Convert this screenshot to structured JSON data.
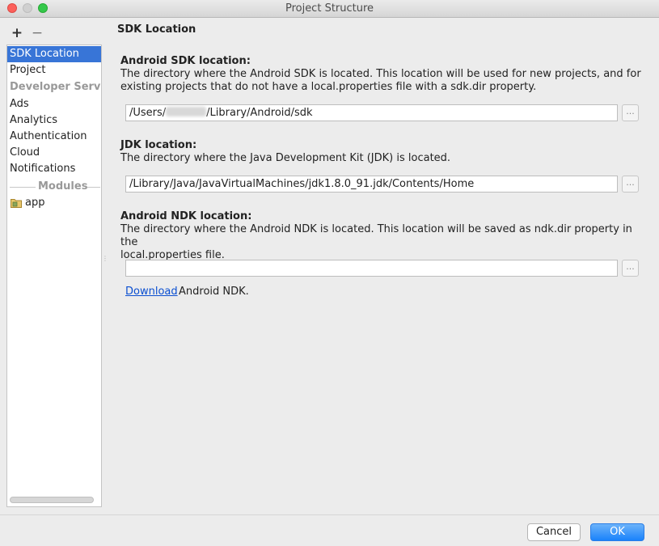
{
  "window": {
    "title": "Project Structure"
  },
  "toolbar": {
    "add_label": "+",
    "remove_label": "−"
  },
  "sidebar": {
    "items": [
      {
        "label": "SDK Location",
        "selected": true
      },
      {
        "label": "Project"
      }
    ],
    "developer_services_header": "Developer Services",
    "services": [
      "Ads",
      "Analytics",
      "Authentication",
      "Cloud",
      "Notifications"
    ],
    "modules_header": "Modules",
    "modules": [
      {
        "label": "app",
        "icon": "module-folder-icon"
      }
    ]
  },
  "content": {
    "page_title": "SDK Location",
    "android_sdk": {
      "title": "Android SDK location:",
      "desc_line1": "The directory where the Android SDK is located. This location will be used for new projects, and for",
      "desc_line2": "existing projects that do not have a local.properties file with a sdk.dir property.",
      "path_prefix": "/Users/",
      "path_suffix": "/Library/Android/sdk",
      "browse_label": "..."
    },
    "jdk": {
      "title": "JDK location:",
      "desc": "The directory where the Java Development Kit (JDK) is located.",
      "path": "/Library/Java/JavaVirtualMachines/jdk1.8.0_91.jdk/Contents/Home",
      "browse_label": "..."
    },
    "android_ndk": {
      "title": "Android NDK location:",
      "desc_line1": "The directory where the Android NDK is located. This location will be saved as ndk.dir property in the",
      "desc_line2": "local.properties file.",
      "path": "",
      "browse_label": "...",
      "download_link": "Download",
      "download_rest": "Android NDK."
    }
  },
  "footer": {
    "cancel_label": "Cancel",
    "ok_label": "OK"
  },
  "colors": {
    "selection": "#3875d7",
    "ok_button": "#1a82fb",
    "link": "#0b4fd1"
  }
}
